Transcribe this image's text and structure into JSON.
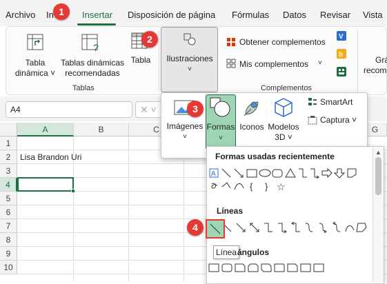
{
  "menu": {
    "items": [
      "Archivo",
      "Inicio",
      "Insertar",
      "Disposición de página",
      "Fórmulas",
      "Datos",
      "Revisar",
      "Vista"
    ],
    "active": "Insertar"
  },
  "ribbon": {
    "tabla_dinamica": "Tabla dinámica",
    "tablas_recomendadas_1": "Tablas dinámicas",
    "tablas_recomendadas_2": "recomendadas",
    "tabla": "Tabla",
    "group_tablas": "Tablas",
    "ilustraciones": "Ilustraciones",
    "obtener_complementos": "Obtener complementos",
    "mis_complementos": "Mis complementos",
    "group_complementos": "Complementos",
    "cut_gra": "Grá",
    "cut_recom": "recome"
  },
  "formula_bar": {
    "name_box": "A4"
  },
  "grid": {
    "columns": [
      "A",
      "B",
      "C",
      "G"
    ],
    "rows": [
      "1",
      "2",
      "3",
      "4",
      "5",
      "6",
      "7",
      "8",
      "9",
      "10"
    ],
    "cell_a2": "Lisa Brandon Uri"
  },
  "illustrations_popup": {
    "imagenes": "Imágenes",
    "formas": "Formas",
    "iconos": "Iconos",
    "modelos_1": "Modelos",
    "modelos_2": "3D",
    "smartart": "SmartArt",
    "captura": "Captura"
  },
  "shapes_popup": {
    "recent_title": "Formas usadas recientemente",
    "lines_title": "Líneas",
    "rect_title": "Rectángulos",
    "tooltip": "Línea"
  },
  "badges": [
    "1",
    "2",
    "3",
    "4"
  ],
  "colors": {
    "accent": "#1d6f42",
    "badge": "#e53935",
    "highlight": "#9fd5b5"
  }
}
